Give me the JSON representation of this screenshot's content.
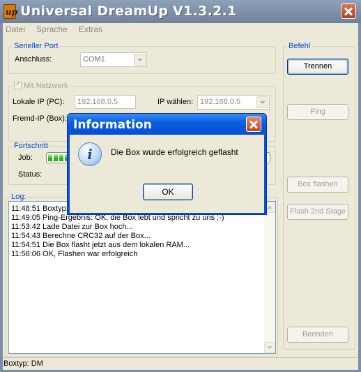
{
  "window": {
    "title": "Universal DreamUp V1.3.2.1",
    "logo_text": "up"
  },
  "menu": {
    "items": [
      "Datei",
      "Sprache",
      "Extras"
    ]
  },
  "serial_port": {
    "legend": "Serieller Port",
    "port_label": "Anschluss:",
    "port_value": "COM1"
  },
  "network": {
    "legend": "Mit Netzwerk",
    "checked": true,
    "local_ip_label": "Lokale IP (PC):",
    "local_ip_value": "192.168.0.5",
    "select_ip_label": "IP wählen:",
    "select_ip_value": "192.168.0.5",
    "foreign_ip_label": "Fremd-IP (Box):"
  },
  "progress": {
    "legend": "Fortschritt",
    "job_label": "Job:",
    "status_label": "Status:",
    "job_fraction": 0.1
  },
  "log": {
    "legend": "Log:",
    "lines": [
      "11:48:51 Boxtyp:",
      "11:49:05 Ping-Ergebnis: OK, die Box lebt und spricht zu uns ;-)",
      "11:53:42 Lade Datei zur Box hoch...",
      "11:54:43 Berechne CRC32 auf der Box...",
      "11:54:51 Die Box flasht jetzt aus dem lokalen RAM...",
      "11:56:06 OK, Flashen war erfolgreich"
    ]
  },
  "command": {
    "legend": "Befehl",
    "disconnect": "Trennen",
    "ping": "Ping",
    "flash_box": "Box flashen",
    "flash_2nd": "Flash 2nd Stage",
    "quit": "Beenden"
  },
  "statusbar": {
    "text": "Boxtyp: DM"
  },
  "dialog": {
    "title": "Information",
    "message": "Die Box wurde erfolgreich geflasht",
    "ok": "OK",
    "icon": "info-icon"
  },
  "colors": {
    "legend_blue": "#0046d5",
    "progress_green": "#34b822",
    "dialog_titlebar": "#0a5fe0"
  }
}
